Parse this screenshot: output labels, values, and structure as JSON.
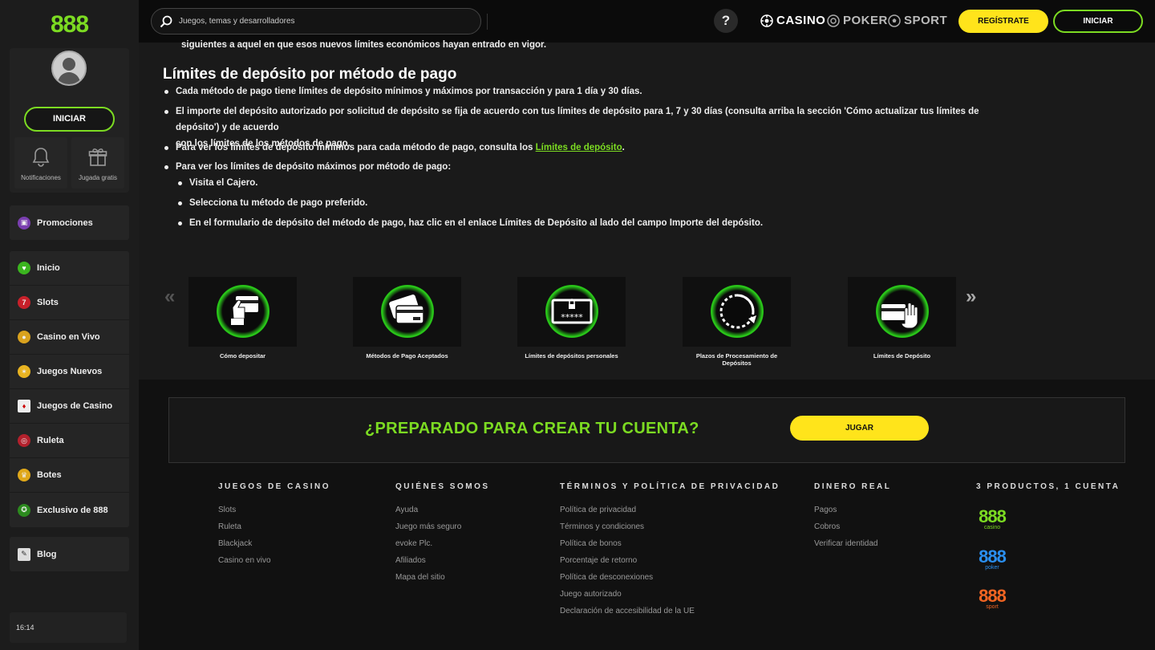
{
  "logo": "888",
  "sidebar": {
    "login_label": "INICIAR",
    "quick": [
      {
        "label": "Notificaciones",
        "icon": "bell-icon"
      },
      {
        "label": "Jugada gratis",
        "icon": "gift-icon"
      }
    ],
    "promo": {
      "label": "Promociones",
      "icon": "gift-icon"
    },
    "items": [
      {
        "label": "Inicio",
        "icon": "heart-icon"
      },
      {
        "label": "Slots",
        "icon": "slot-machine-icon"
      },
      {
        "label": "Casino en Vivo",
        "icon": "live-dealer-icon"
      },
      {
        "label": "Juegos Nuevos",
        "icon": "star-burst-icon"
      },
      {
        "label": "Juegos de Casino",
        "icon": "cards-icon"
      },
      {
        "label": "Ruleta",
        "icon": "roulette-icon"
      },
      {
        "label": "Botes",
        "icon": "trophy-icon"
      },
      {
        "label": "Exclusivo de 888",
        "icon": "chip-icon"
      }
    ],
    "blog": {
      "label": "Blog",
      "icon": "edit-icon"
    },
    "time": "16:14"
  },
  "header": {
    "search_placeholder": "Juegos, temas y desarrolladores",
    "help": "?",
    "products": [
      "CASINO",
      "POKER",
      "SPORT"
    ],
    "register_label": "REGÍSTRATE",
    "login_label": "INICIAR"
  },
  "content": {
    "top_line": "siguientes a aquel en que esos nuevos límites económicos hayan entrado en vigor.",
    "title": "Límites de depósito por método de pago",
    "bullets": [
      "Cada método de pago tiene límites de depósito mínimos y máximos por transacción y para 1 día y 30 días.",
      "El importe del depósito autorizado por solicitud de depósito se fija de acuerdo con tus límites de depósito para 1, 7 y 30 días (consulta arriba la sección 'Cómo actualizar tus límites de depósito') y de acuerdo",
      "con los límites de los métodos de pago.",
      "Para ver los límites de depósito mínimos para cada método de pago, consulta los ",
      "Límites de depósito",
      ".",
      "Para ver los límites de depósito máximos por método de pago:"
    ],
    "sub_bullets": [
      "Visita el Cajero.",
      "Selecciona tu método de pago preferido.",
      "En el formulario de depósito del método de pago, haz clic en el enlace Límites de Depósito al lado del campo Importe del depósito."
    ],
    "arrows": {
      "prev": "«",
      "next": "»"
    },
    "cards": [
      {
        "label": "Cómo depositar",
        "icon": "hand-card-icon"
      },
      {
        "label": "Métodos de Pago Aceptados",
        "icon": "credit-cards-icon"
      },
      {
        "label": "Límites de depósitos personales",
        "icon": "password-lock-icon"
      },
      {
        "label": "Plazos de Procesamiento de Depósitos",
        "icon": "clock-arrow-icon"
      },
      {
        "label": "Límites de Depósito",
        "icon": "hand-stop-icon"
      }
    ]
  },
  "cta": {
    "text": "¿PREPARADO PARA CREAR TU CUENTA?",
    "button": "JUGAR"
  },
  "footer": {
    "cols": [
      {
        "head": "JUEGOS DE CASINO",
        "links": [
          "Slots",
          "Ruleta",
          "Blackjack",
          "Casino en vivo"
        ]
      },
      {
        "head": "QUIÉNES SOMOS",
        "links": [
          "Ayuda",
          "Juego más seguro",
          "evoke Plc.",
          "Afiliados",
          "Mapa del sitio"
        ]
      },
      {
        "head": "TÉRMINOS Y POLÍTICA DE PRIVACIDAD",
        "links": [
          "Política de privacidad",
          "Términos y condiciones",
          "Política de bonos",
          "Porcentaje de retorno",
          "Política de desconexiones",
          "Juego autorizado",
          "Declaración de accesibilidad de la UE"
        ]
      },
      {
        "head": "DINERO REAL",
        "links": [
          "Pagos",
          "Cobros",
          "Verificar identidad"
        ]
      },
      {
        "head": "3 PRODUCTOS, 1 CUENTA",
        "links": []
      }
    ],
    "brands": [
      {
        "num": "888",
        "sub": "casino",
        "color": "#7cdb22"
      },
      {
        "num": "888",
        "sub": "poker",
        "color": "#2a8ff0"
      },
      {
        "num": "888",
        "sub": "sport",
        "color": "#f26522"
      }
    ]
  },
  "colors": {
    "accent": "#7cdb22",
    "yellow": "#ffe41b"
  }
}
